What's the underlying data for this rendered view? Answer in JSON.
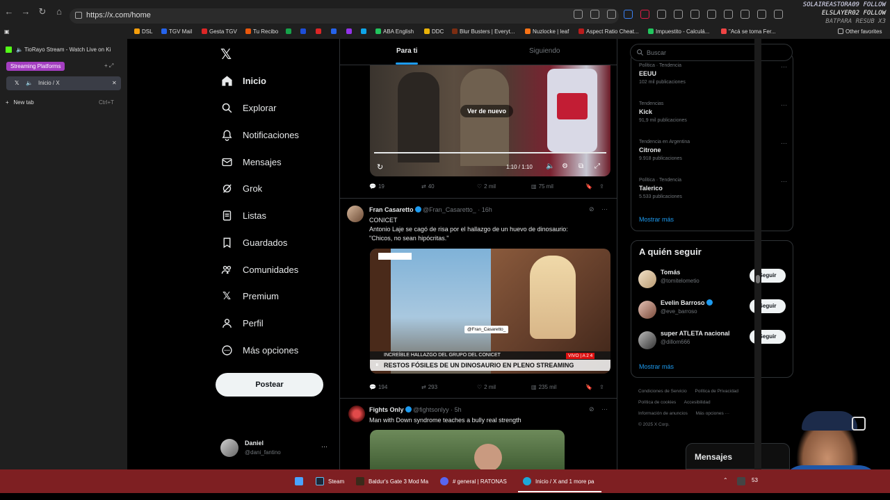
{
  "browser": {
    "url": "https://x.com/home",
    "bookmarks": [
      "DSL",
      "TGV Mail",
      "Gesta TGV",
      "Tu Recibo",
      "ABA English",
      "DDC",
      "Blur Busters | Everyt...",
      "Nuzlocke | leaf",
      "Aspect Ratio Cheat...",
      "Impuestito - Calculá...",
      "\"Acá se toma Fer...",
      "Other favorites"
    ],
    "tabs": {
      "pinned": "TioRayo Stream - Watch Live on Ki",
      "group": "Streaming Platforms",
      "active": "Inicio / X",
      "new_tab": "New tab",
      "new_tab_shortcut": "Ctrl+T"
    }
  },
  "nav": {
    "items": [
      "Inicio",
      "Explorar",
      "Notificaciones",
      "Mensajes",
      "Grok",
      "Listas",
      "Guardados",
      "Comunidades",
      "Premium",
      "Perfil",
      "Más opciones"
    ],
    "post_label": "Postear",
    "profile_name": "Daniel",
    "profile_handle": "@dani_fantino"
  },
  "timeline": {
    "tabs": [
      "Para ti",
      "Siguiendo"
    ],
    "posts": [
      {
        "replay_label": "Ver de nuevo",
        "time_label": "1:10 / 1:10",
        "stats": {
          "replies": "19",
          "reposts": "40",
          "likes": "2 mil",
          "views": "75 mil"
        }
      },
      {
        "name": "Fran Casaretto",
        "handle": "@Fran_Casaretto_ · 16h",
        "text_line1": "CONICET",
        "text_line2": "Antonio Laje se cagó de risa por el hallazgo de un huevo de dinosaurio:",
        "text_line3": "\"Chicos, no sean hipócritas.\"",
        "video_tag": "@Fran_Casaretto_",
        "chyron_top": "INCREÍBLE HALLAZGO DEL GRUPO DEL CONICET",
        "chyron_main": "RESTOS FÓSILES DE UN DINOSAURIO EN PLENO STREAMING",
        "live_badge": "VIVO | A 2 4",
        "stats": {
          "replies": "194",
          "reposts": "293",
          "likes": "2 mil",
          "views": "235 mil"
        }
      },
      {
        "name": "Fights Only",
        "handle": "@fightsonlyy · 5h",
        "text": "Man with Down syndrome teaches a bully real strength"
      }
    ]
  },
  "right": {
    "search_placeholder": "Buscar",
    "trends": [
      {
        "context": "Política · Tendencia",
        "name": "EEUU",
        "count": "102 mil publicaciones"
      },
      {
        "context": "Tendencias",
        "name": "Kick",
        "count": "91,9 mil publicaciones"
      },
      {
        "context": "Tendencia en Argentina",
        "name": "Citrone",
        "count": "9.918 publicaciones"
      },
      {
        "context": "Política · Tendencia",
        "name": "Talerico",
        "count": "5.533 publicaciones"
      }
    ],
    "show_more": "Mostrar más",
    "who_title": "A quién seguir",
    "who": [
      {
        "name": "Tomás",
        "handle": "@tomitelometio"
      },
      {
        "name": "Evelin Barroso",
        "handle": "@eve_barroso"
      },
      {
        "name": "super ATLETA nacional",
        "handle": "@dillom666"
      }
    ],
    "follow_label": "Seguir",
    "footer": [
      "Condiciones de Servicio",
      "Política de Privacidad",
      "Política de cookies",
      "Accesibilidad",
      "Información de anuncios",
      "Más opciones ···",
      "© 2025 X Corp."
    ],
    "messages": "Mensajes"
  },
  "taskbar": {
    "items": [
      "Steam",
      "Baldur's Gate 3 Mod Ma",
      "# general | RATONAS",
      "Inicio / X and 1 more pa"
    ],
    "badge_count": "53"
  },
  "overlay": {
    "line1": "SOLAIREASTORA09 FOLLOW",
    "line2": "ELSLAYER02 FOLLOW",
    "line3": "BATPARA RESUB X3"
  },
  "colors": {
    "accent": "#1d9bf0",
    "taskbar": "#7e1f22",
    "group": "#a43ec1"
  }
}
